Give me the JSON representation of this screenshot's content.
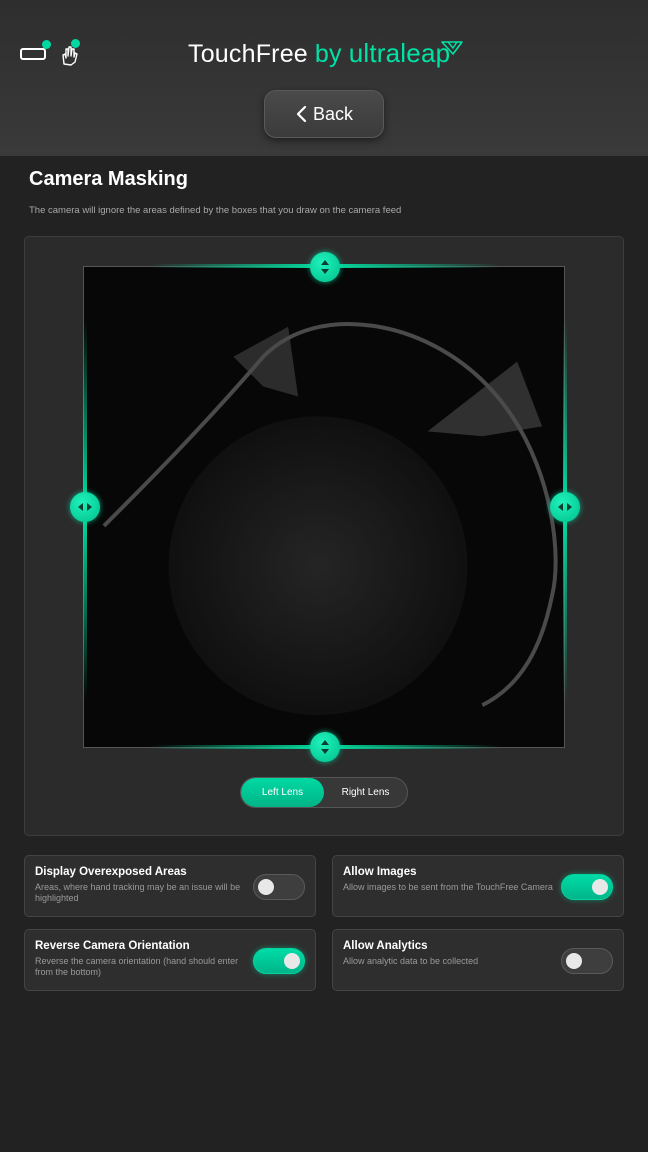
{
  "header": {
    "brand_main": "TouchFree",
    "brand_by": "by",
    "brand_company": "ultraleap",
    "back_label": "Back",
    "icons": [
      "camera-status-icon",
      "hand-status-icon",
      "ultraleap-logo-icon",
      "chevron-left-icon"
    ]
  },
  "page": {
    "title": "Camera Masking",
    "description": "The camera will ignore the areas defined by the boxes that you draw on the camera feed"
  },
  "lens": {
    "left_label": "Left Lens",
    "right_label": "Right Lens",
    "selected": "Left Lens"
  },
  "settings": [
    {
      "title": "Display Overexposed Areas",
      "description": "Areas, where hand tracking may be an issue will be highlighted",
      "enabled": false
    },
    {
      "title": "Allow Images",
      "description": "Allow images to be sent from the TouchFree Camera",
      "enabled": true
    },
    {
      "title": "Reverse Camera Orientation",
      "description": "Reverse the camera orientation (hand should enter from the bottom)",
      "enabled": true
    },
    {
      "title": "Allow Analytics",
      "description": "Allow analytic data to be collected",
      "enabled": false
    }
  ],
  "colors": {
    "accent": "#00e0a2",
    "background": "#222222",
    "header": "#333333",
    "card": "#2e2e2e"
  }
}
